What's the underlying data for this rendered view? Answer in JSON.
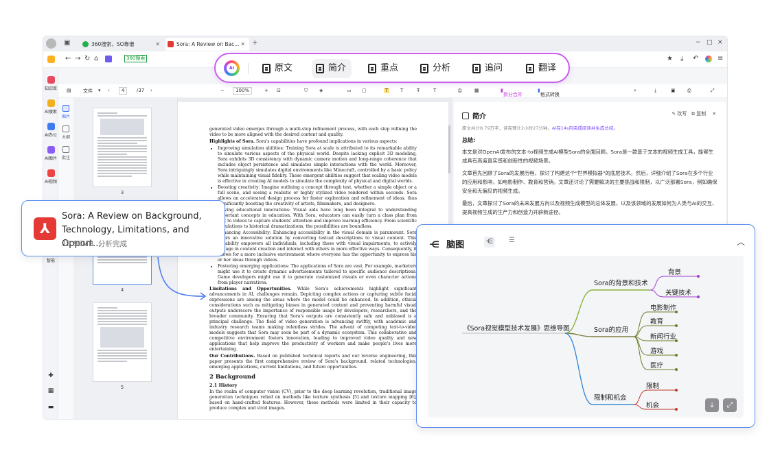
{
  "browser": {
    "tabs": [
      {
        "label": "360搜索，SO靠谱"
      },
      {
        "label": "Sora: A Review on Bac..."
      }
    ],
    "url_badge": "360搜索",
    "new_tab": "+",
    "window_controls": [
      "−",
      "□",
      "×"
    ]
  },
  "left_sidebar": [
    {
      "label": "知识库",
      "color": "#e84a5f"
    },
    {
      "label": "AI搜索",
      "color": "#2f6fe8"
    },
    {
      "label": "AI办公",
      "color": "#3d7bf0"
    },
    {
      "label": "AI图片",
      "color": "#8b5cf6"
    },
    {
      "label": "AI视频",
      "color": "#ef4444"
    },
    {
      "label": "智能",
      "color": "#22a06b"
    }
  ],
  "pdf_toolbar": {
    "file_menu": "文件",
    "page_current": "4",
    "page_total": "/37",
    "zoom": "100%",
    "split_merge": "拆分合并",
    "format_convert": "格式转换"
  },
  "thumb_side": [
    {
      "label": "图片"
    },
    {
      "label": "大纲"
    },
    {
      "label": "批注"
    }
  ],
  "thumb_pages": [
    "3",
    "4",
    "5"
  ],
  "ai_toolbar": {
    "items": [
      {
        "label": "原文",
        "active": false
      },
      {
        "label": "简介",
        "active": true
      },
      {
        "label": "重点",
        "active": false
      },
      {
        "label": "分析",
        "active": false
      },
      {
        "label": "追问",
        "active": false
      },
      {
        "label": "翻译",
        "active": false
      }
    ]
  },
  "pdf_page": {
    "intro": "generated video emerges through a multi-step refinement process, with each step refining the video to be more aligned with the desired content and quality.",
    "highlights_title": "Highlights of Sora.",
    "highlights_text": "Sora's capabilities have profound implications in various aspects:",
    "bullets": [
      "Improving simulation abilities: Training Sora at scale is attributed to its remarkable ability to simulate various aspects of the physical world. Despite lacking explicit 3D modeling, Sora exhibits 3D consistency with dynamic camera motion and long-range coherence that includes object persistence and simulates simple interactions with the world. Moreover, Sora intriguingly simulates digital environments like Minecraft, controlled by a basic policy while maintaining visual fidelity. These emergent abilities suggest that scaling video models is effective in creating AI models to simulate the complexity of physical and digital worlds.",
      "Boosting creativity: Imagine outlining a concept through text, whether a simple object or a full scene, and seeing a realistic or highly stylized video rendered within seconds. Sora allows an accelerated design process for faster exploration and refinement of ideas, thus significantly boosting the creativity of artists, filmmakers, and designers.",
      "Driving educational innovations: Visual aids have long been integral to understanding important concepts in education. With Sora, educators can easily turn a class plan from text to videos to capture students' attention and improve learning efficiency. From scientific simulations to historical dramatizations, the possibilities are boundless.",
      "Enhancing Accessibility: Enhancing accessibility in the visual domain is paramount. Sora offers an innovative solution by converting textual descriptions to visual content. This capability empowers all individuals, including those with visual impairments, to actively engage in content creation and interact with others in more effective ways. Consequently, it allows for a more inclusive environment where everyone has the opportunity to express his or her ideas through videos.",
      "Fostering emerging applications: The applications of Sora are vast. For example, marketers might use it to create dynamic advertisements tailored to specific audience descriptions. Game developers might use it to generate customized visuals or even character actions from player narratives."
    ],
    "limits_title": "Limitations and Opportunities.",
    "limits_text": "While Sora's achievements highlight significant advancements in AI, challenges remain. Depicting complex actions or capturing subtle facial expressions are among the areas where the model could be enhanced. In addition, ethical considerations such as mitigating biases in generated content and preventing harmful visual outputs underscore the importance of responsible usage by developers, researchers, and the broader community. Ensuring that Sora's outputs are consistently safe and unbiased is a principal challenge. The field of video generation is advancing swiftly, with academic and industry research teams making relentless strides. The advent of competing text-to-video models suggests that Sora may soon be part of a dynamic ecosystem. This collaborative and competitive environment fosters innovation, leading to improved video quality and new applications that help improve the productivity of workers and make people's lives more entertaining.",
    "contrib_title": "Our Contributions.",
    "contrib_text": "Based on published technical reports and our reverse engineering, this paper presents the first comprehensive review of Sora's background, related technologies, emerging applications, current limitations, and future opportunities.",
    "section": "2   Background",
    "subsection": "2.1   History",
    "history_text": "In the realm of computer vision (CV), prior to the deep learning revolution, traditional image generation techniques relied on methods like texture synthesis [5] and texture mapping [6], based on hand-crafted features. However, these methods were limited in their capacity to produce complex and vivid images."
  },
  "summary": {
    "title": "简介",
    "rewrite": "改写",
    "copy": "复制",
    "meta": "原文共计8.79万字，读完预计2小时27分钟。",
    "meta_link": "AI在14s内完成阅读并生成总结。",
    "label": "总结:",
    "paragraphs": [
      "本文是对OpenAI发布的文本-to视频生成AI模型Sora的全面回顾。Sora是一款基于文本的视频生成工具，能够生成具有高度真实感和创新性的视频场景。",
      "文章首先回顾了Sora的发展历程，探讨了构建这个\"世界模拟器\"的底层技术。然后，详细介绍了Sora在多个行业的应用和影响，如电影制作、教育和营销。文章还讨论了需要解决的主要挑战和限制，以广泛部署Sora，例如确保安全和无偏见的视频生成。",
      "最后，文章探讨了Sora的未来发展方向以及视频生成模型的总体发展，以及该领域的发展如何为人类与AI的交互、提高视频生成的生产力和创造力开辟新途径。"
    ]
  },
  "file_card": {
    "title": "Sora: A Review on Background, Technology, Limitations, and Opport...",
    "size": "19.96MB",
    "status": "分析完成"
  },
  "mindmap": {
    "title": "脑图",
    "root": "《Sora视觉模型技术发展》思维导图",
    "branches": [
      {
        "label": "Sora的背景和技术",
        "color": "#8bb33a",
        "children": [
          "背景",
          "关键技术"
        ],
        "child_color": "#a23ccf"
      },
      {
        "label": "Sora的应用",
        "color": "#7d7d3a",
        "children": [
          "电影制作",
          "教育",
          "新闻行业",
          "游戏",
          "医疗"
        ],
        "child_color": "#6b7d2a"
      },
      {
        "label": "限制和机会",
        "color": "#3a8ad6",
        "children": [
          "限制",
          "机会"
        ],
        "child_color": "#c0392b"
      }
    ]
  }
}
